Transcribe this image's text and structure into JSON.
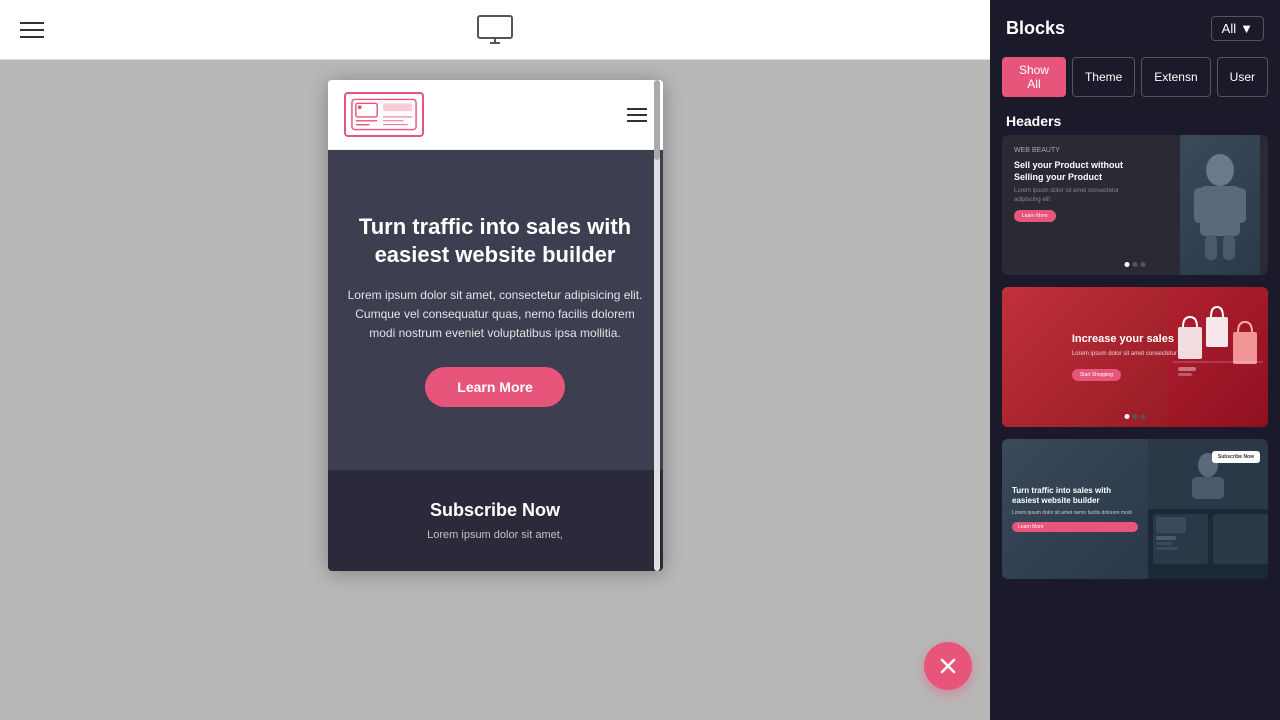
{
  "topbar": {
    "monitor_icon_label": "monitor"
  },
  "sidebar": {
    "title": "Blocks",
    "all_dropdown": "All",
    "filters": [
      {
        "label": "Show All",
        "active": true
      },
      {
        "label": "Theme",
        "active": false
      },
      {
        "label": "Extensn",
        "active": false
      },
      {
        "label": "User",
        "active": false
      }
    ],
    "section_label": "Headers",
    "preview1": {
      "top_label": "WEB BEAUTY",
      "title": "Sell your Product without Selling your Product",
      "body_text": "Lorem ipsum dolor sit amet consectetur adipiscing elit",
      "btn_label": "Learn More"
    },
    "preview2": {
      "title": "Increase your sales",
      "body_text": "Lorem ipsum dolor sit amet consectetur",
      "btn_label": "Start Shopping"
    },
    "preview3": {
      "title": "Turn traffic into sales with easiest website builder",
      "body_text": "Lorem ipsum dolor sit amet nemo facilis dolorem modi",
      "btn_label": "Learn More",
      "sub_btn": "Subscribe Now"
    }
  },
  "canvas": {
    "mobile_preview": {
      "nav_placeholder": "logo",
      "hero_title": "Turn traffic into sales with easiest website builder",
      "hero_body": "Lorem ipsum dolor sit amet, consectetur adipisicing elit. Cumque vel consequatur quas, nemo facilis dolorem modi nostrum eveniet voluptatibus ipsa mollitia.",
      "hero_btn": "Learn More",
      "subscribe_title": "Subscribe Now",
      "subscribe_body": "Lorem ipsum dolor sit amet,"
    }
  },
  "float_button": {
    "icon": "×",
    "label": "close"
  }
}
